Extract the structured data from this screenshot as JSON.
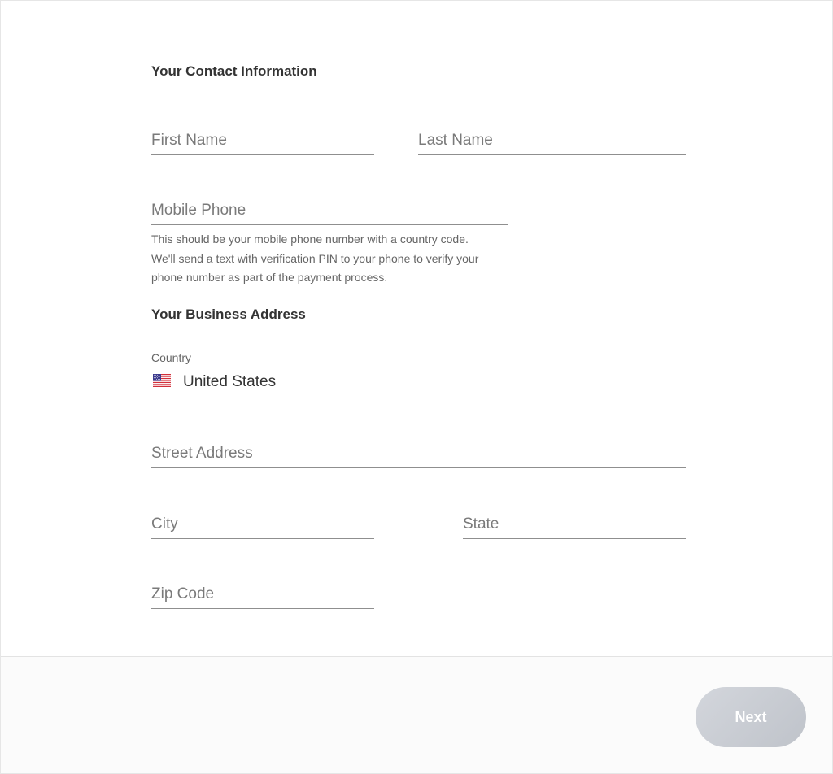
{
  "contact": {
    "title": "Your Contact Information",
    "first_name_placeholder": "First Name",
    "last_name_placeholder": "Last Name",
    "mobile_phone_placeholder": "Mobile Phone",
    "mobile_help_line1": "This should be your mobile phone number with a country code.",
    "mobile_help_line2": "We'll send a text with verification PIN to your phone to verify your",
    "mobile_help_line3": "phone number as part of the payment process."
  },
  "address": {
    "title": "Your Business Address",
    "country_label": "Country",
    "country_value": "United States",
    "country_flag_icon": "us-flag-icon",
    "street_placeholder": "Street Address",
    "city_placeholder": "City",
    "state_placeholder": "State",
    "zip_placeholder": "Zip Code"
  },
  "footer": {
    "next_label": "Next"
  },
  "colors": {
    "button_bg": "#c9ccd2",
    "button_text": "#ffffff",
    "field_underline": "#8f8f8f",
    "placeholder": "#7a7a7a"
  }
}
